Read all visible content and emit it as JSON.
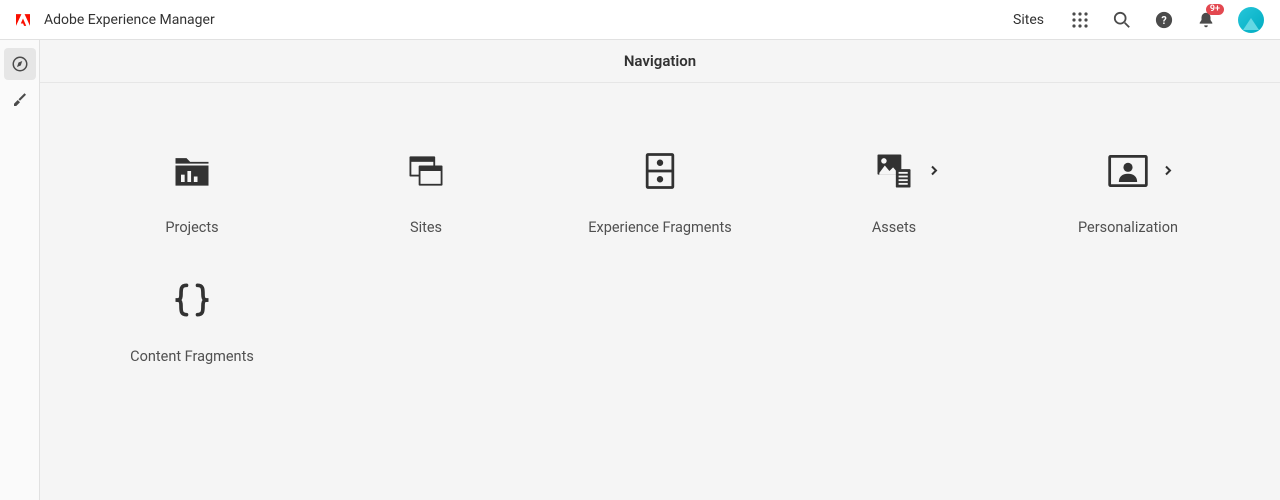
{
  "header": {
    "app_title": "Adobe Experience Manager",
    "context": "Sites",
    "notification_badge": "9+"
  },
  "main": {
    "title": "Navigation"
  },
  "tiles": {
    "projects": {
      "label": "Projects"
    },
    "sites": {
      "label": "Sites"
    },
    "experience_fragments": {
      "label": "Experience Fragments"
    },
    "assets": {
      "label": "Assets"
    },
    "personalization": {
      "label": "Personalization"
    },
    "content_fragments": {
      "label": "Content Fragments"
    }
  }
}
